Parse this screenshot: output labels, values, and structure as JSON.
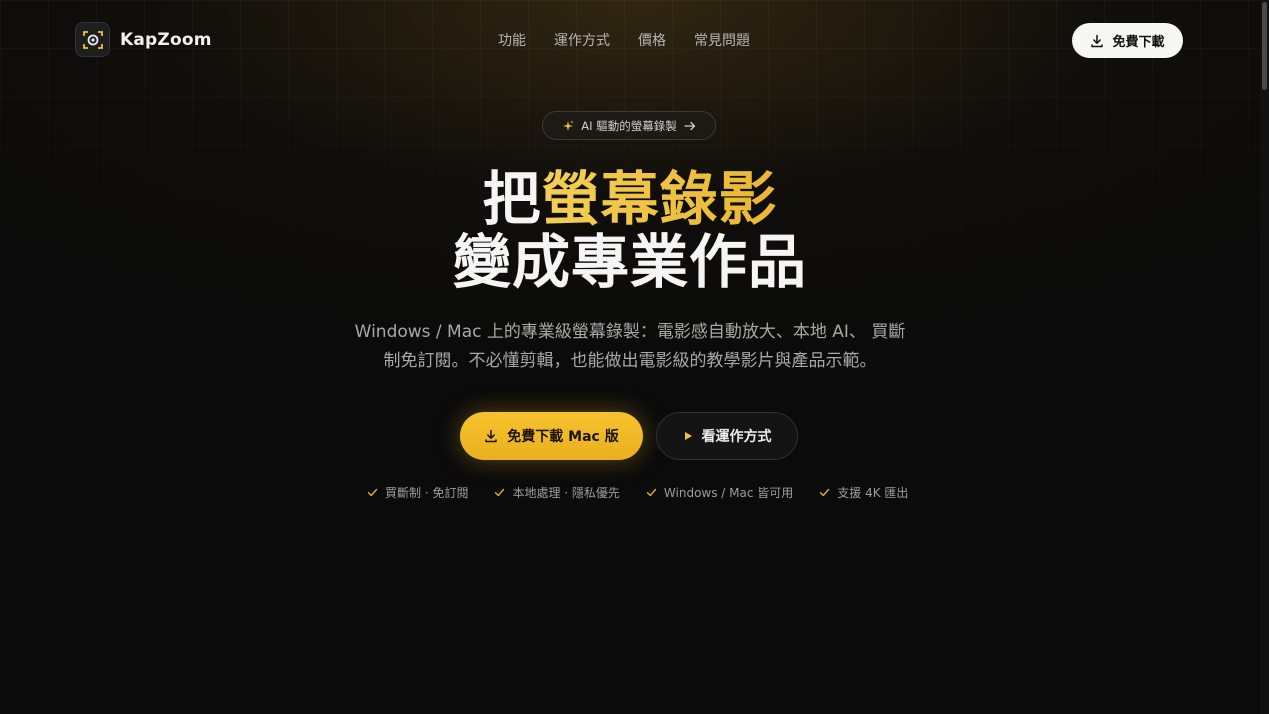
{
  "nav": {
    "brand": "KapZoom",
    "links": [
      "功能",
      "運作方式",
      "價格",
      "常見問題"
    ],
    "download_label": "免費下載"
  },
  "badge": {
    "label": "AI 驅動的螢幕錄製"
  },
  "hero": {
    "line1_white": "把",
    "line1_gold": "螢幕錄影",
    "line2": "變成專業作品",
    "subtitle_line1": "Windows / Mac 上的專業級螢幕錄製：電影感自動放大、本地 AI、 買斷",
    "subtitle_line2": "制免訂閱。不必懂剪輯，也能做出電影級的教學影片與產品示範。"
  },
  "cta": {
    "primary_label": "免費下載 Mac 版",
    "secondary_label": "看運作方式"
  },
  "features": [
    "買斷制 · 免訂閱",
    "本地處理 · 隱私優先",
    "Windows / Mac 皆可用",
    "支援 4K 匯出"
  ],
  "colors": {
    "accent": "#f0c33c",
    "background": "#0b0b0b"
  }
}
